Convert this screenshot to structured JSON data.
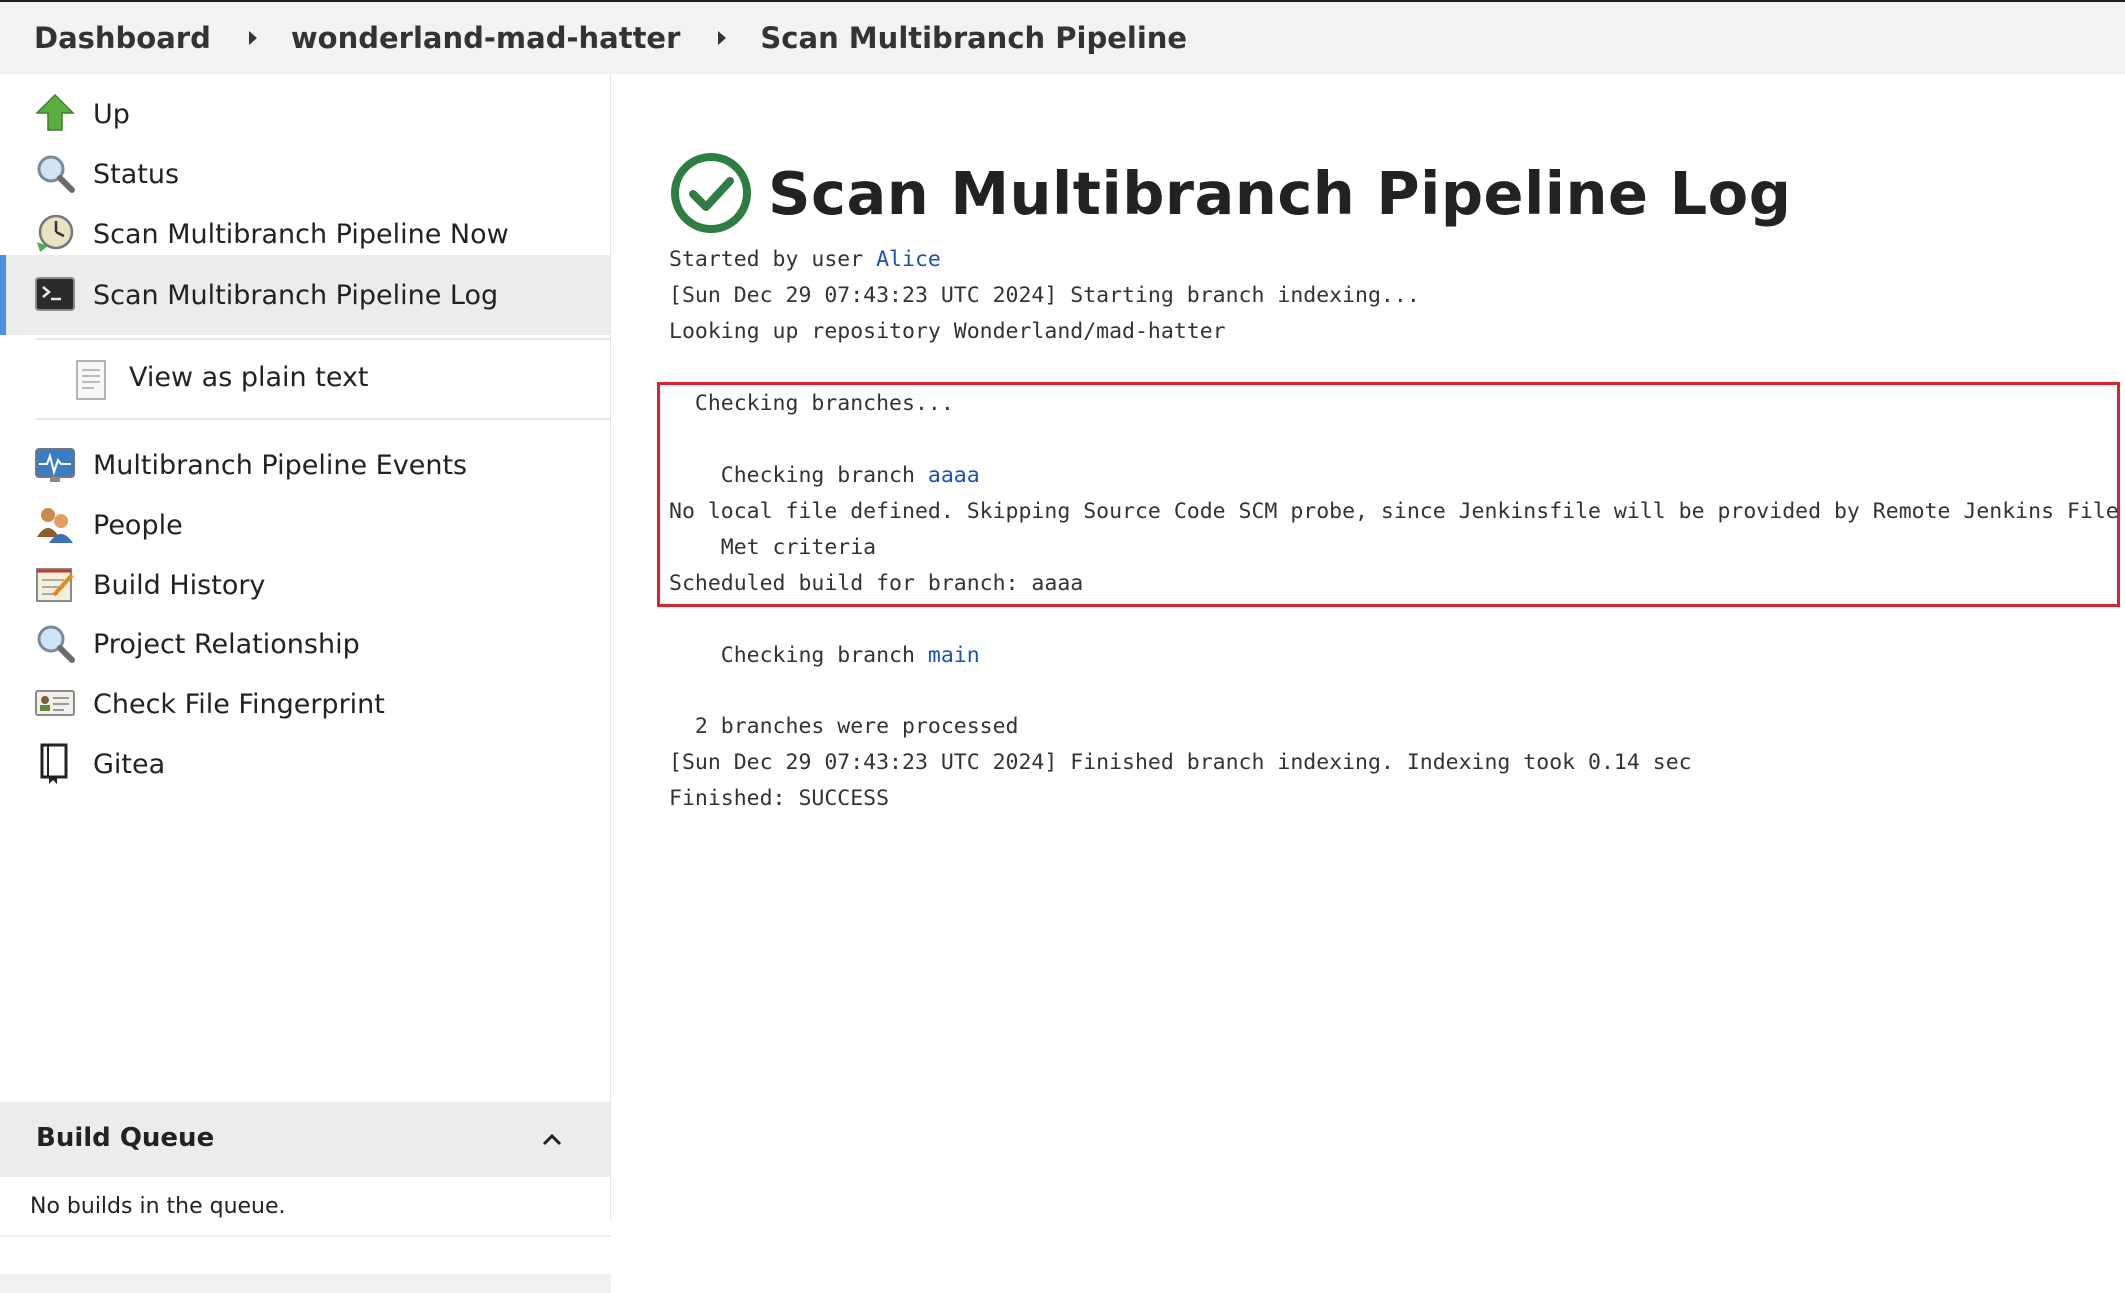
{
  "breadcrumb": {
    "items": [
      "Dashboard",
      "wonderland-mad-hatter",
      "Scan Multibranch Pipeline"
    ]
  },
  "sidebar": {
    "items": [
      {
        "label": "Up",
        "icon": "up-arrow-icon"
      },
      {
        "label": "Status",
        "icon": "magnifier-icon"
      },
      {
        "label": "Scan Multibranch Pipeline Now",
        "icon": "clock-icon"
      },
      {
        "label": "Scan Multibranch Pipeline Log",
        "icon": "terminal-icon",
        "active": true
      },
      {
        "label": "View as plain text",
        "icon": "document-icon"
      },
      {
        "label": "Multibranch Pipeline Events",
        "icon": "monitor-pulse-icon"
      },
      {
        "label": "People",
        "icon": "people-icon"
      },
      {
        "label": "Build History",
        "icon": "notepad-icon"
      },
      {
        "label": "Project Relationship",
        "icon": "magnifier-icon"
      },
      {
        "label": "Check File Fingerprint",
        "icon": "id-card-icon"
      },
      {
        "label": "Gitea",
        "icon": "gitea-icon"
      }
    ]
  },
  "build_queue": {
    "title": "Build Queue",
    "empty_text": "No builds in the queue."
  },
  "main": {
    "title": "Scan Multibranch Pipeline Log",
    "status": "success",
    "log": {
      "started_prefix": "Started by user ",
      "started_user": "Alice",
      "line_indexing_start": "[Sun Dec 29 07:43:23 UTC 2024] Starting branch indexing...",
      "line_lookup": "Looking up repository Wonderland/mad-hatter",
      "line_checking_branches": "  Checking branches...",
      "line_branch_aaaa_prefix": "    Checking branch ",
      "branch_aaaa": "aaaa",
      "line_no_local_file": "No local file defined. Skipping Source Code SCM probe, since Jenkinsfile will be provided by Remote Jenkins File Plugin",
      "line_met_criteria": "    Met criteria",
      "line_scheduled": "Scheduled build for branch: aaaa",
      "line_branch_main_prefix": "    Checking branch ",
      "branch_main": "main",
      "line_processed": "  2 branches were processed",
      "line_finished_indexing": "[Sun Dec 29 07:43:23 UTC 2024] Finished branch indexing. Indexing took 0.14 sec",
      "line_finished": "Finished: SUCCESS"
    }
  },
  "colors": {
    "link": "#1a52b8",
    "success": "#2e7d42",
    "highlight_border": "#d9232e",
    "active_bar": "#4a90e2"
  }
}
